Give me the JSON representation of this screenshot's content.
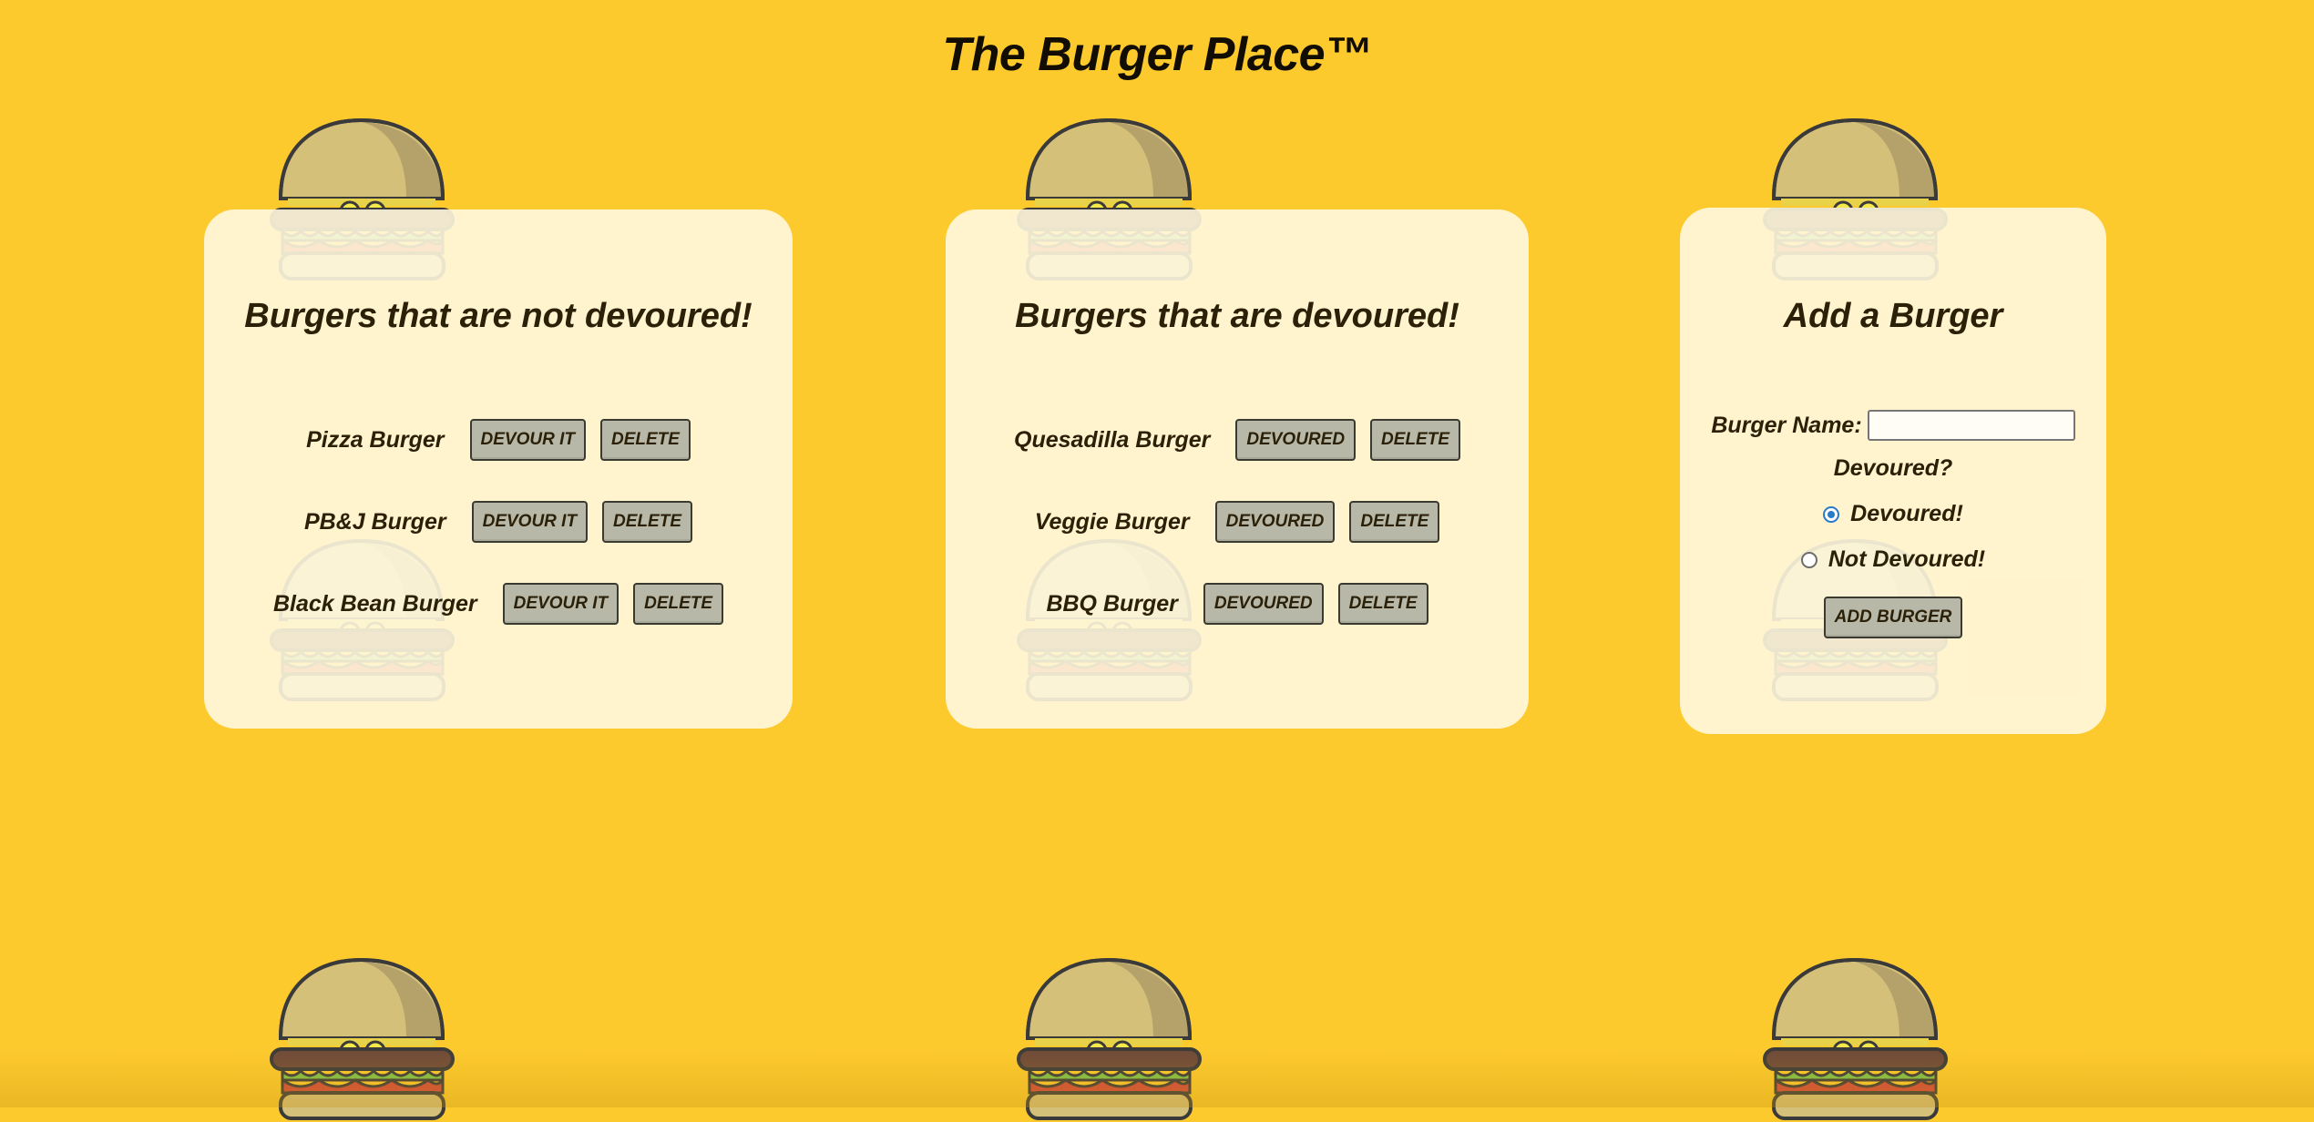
{
  "title": "The Burger Place™",
  "colors": {
    "background": "#fdca2e",
    "panel": "#fff6d8",
    "button": "#b8b8a8",
    "text": "#2b2008",
    "radio_accent": "#2a79c9"
  },
  "not_devoured": {
    "heading": "Burgers that are not devoured!",
    "items": [
      {
        "name": "Pizza Burger",
        "action": "DEVOUR IT",
        "delete": "DELETE"
      },
      {
        "name": "PB&J Burger",
        "action": "DEVOUR IT",
        "delete": "DELETE"
      },
      {
        "name": "Black Bean Burger",
        "action": "DEVOUR IT",
        "delete": "DELETE"
      }
    ]
  },
  "devoured": {
    "heading": "Burgers that are devoured!",
    "items": [
      {
        "name": "Quesadilla Burger",
        "action": "DEVOURED",
        "delete": "DELETE"
      },
      {
        "name": "Veggie Burger",
        "action": "DEVOURED",
        "delete": "DELETE"
      },
      {
        "name": "BBQ Burger",
        "action": "DEVOURED",
        "delete": "DELETE"
      }
    ]
  },
  "add_form": {
    "heading": "Add a Burger",
    "name_label": "Burger Name:",
    "name_value": "",
    "question": "Devoured?",
    "options": [
      {
        "label": "Devoured!",
        "checked": true
      },
      {
        "label": "Not Devoured!",
        "checked": false
      }
    ],
    "submit_label": "ADD BURGER"
  },
  "background_icons": [
    "burger-icon"
  ]
}
